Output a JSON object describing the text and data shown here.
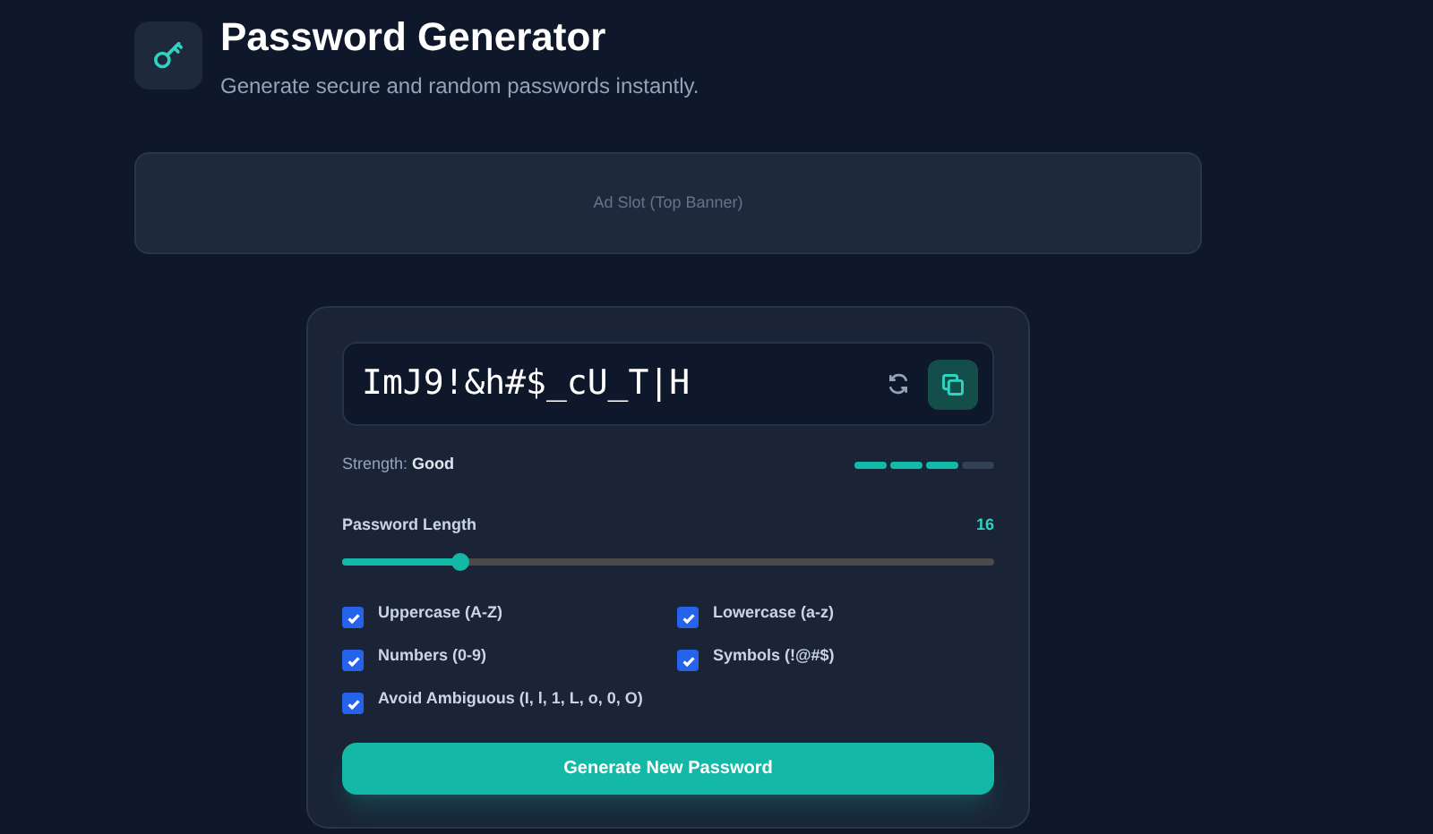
{
  "header": {
    "title": "Password Generator",
    "subtitle": "Generate secure and random passwords instantly."
  },
  "ad_slot": {
    "label": "Ad Slot (Top Banner)"
  },
  "password": {
    "value": "ImJ9!&h#$_cU_T|H"
  },
  "strength": {
    "label": "Strength:",
    "value": "Good",
    "level": 0.75
  },
  "length": {
    "label": "Password Length",
    "value": "16",
    "level": 0.18
  },
  "options": [
    {
      "label": "Uppercase (A-Z)",
      "checked": true
    },
    {
      "label": "Lowercase (a-z)",
      "checked": true
    },
    {
      "label": "Numbers (0-9)",
      "checked": true
    },
    {
      "label": "Symbols (!@#$)",
      "checked": true
    },
    {
      "label": "Avoid Ambiguous (I, l, 1, L, o, 0, O)",
      "checked": true
    }
  ],
  "generate_button": {
    "label": "Generate New Password"
  }
}
